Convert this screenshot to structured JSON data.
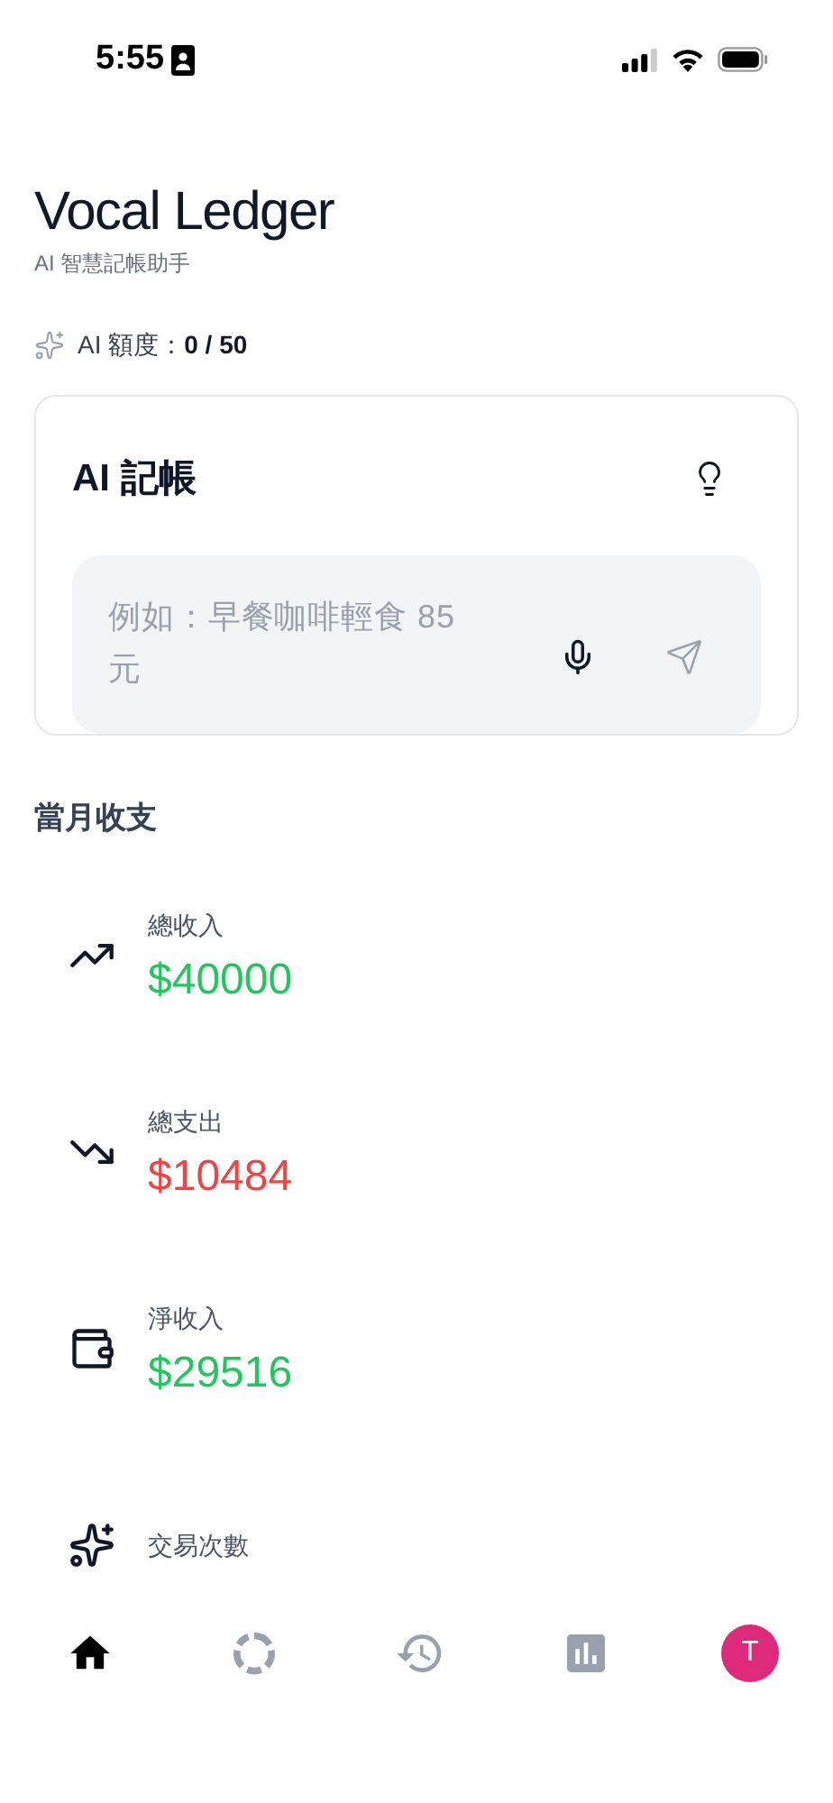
{
  "status_bar": {
    "time": "5:55"
  },
  "header": {
    "title": "Vocal Ledger",
    "subtitle": "AI 智慧記帳助手",
    "quota_label": "AI 額度：",
    "quota_value": "0 / 50"
  },
  "ai_card": {
    "title": "AI 記帳",
    "input": {
      "placeholder": "例如：早餐咖啡輕食 85 元"
    }
  },
  "monthly": {
    "title": "當月收支",
    "stats": [
      {
        "kind": "trend_up",
        "label": "總收入",
        "value": "$40000",
        "color": "#22c55e"
      },
      {
        "kind": "trend_down",
        "label": "總支出",
        "value": "$10484",
        "color": "#ef4444"
      },
      {
        "kind": "wallet",
        "label": "淨收入",
        "value": "$29516",
        "color": "#22c55e"
      },
      {
        "kind": "sparkles",
        "label": "交易次數"
      }
    ]
  },
  "nav": [
    {
      "kind": "home",
      "selected": true
    },
    {
      "kind": "loader",
      "selected": false
    },
    {
      "kind": "history",
      "selected": false
    },
    {
      "kind": "chart",
      "selected": false
    },
    {
      "kind": "avatar",
      "letter": "T",
      "selected": false
    }
  ]
}
